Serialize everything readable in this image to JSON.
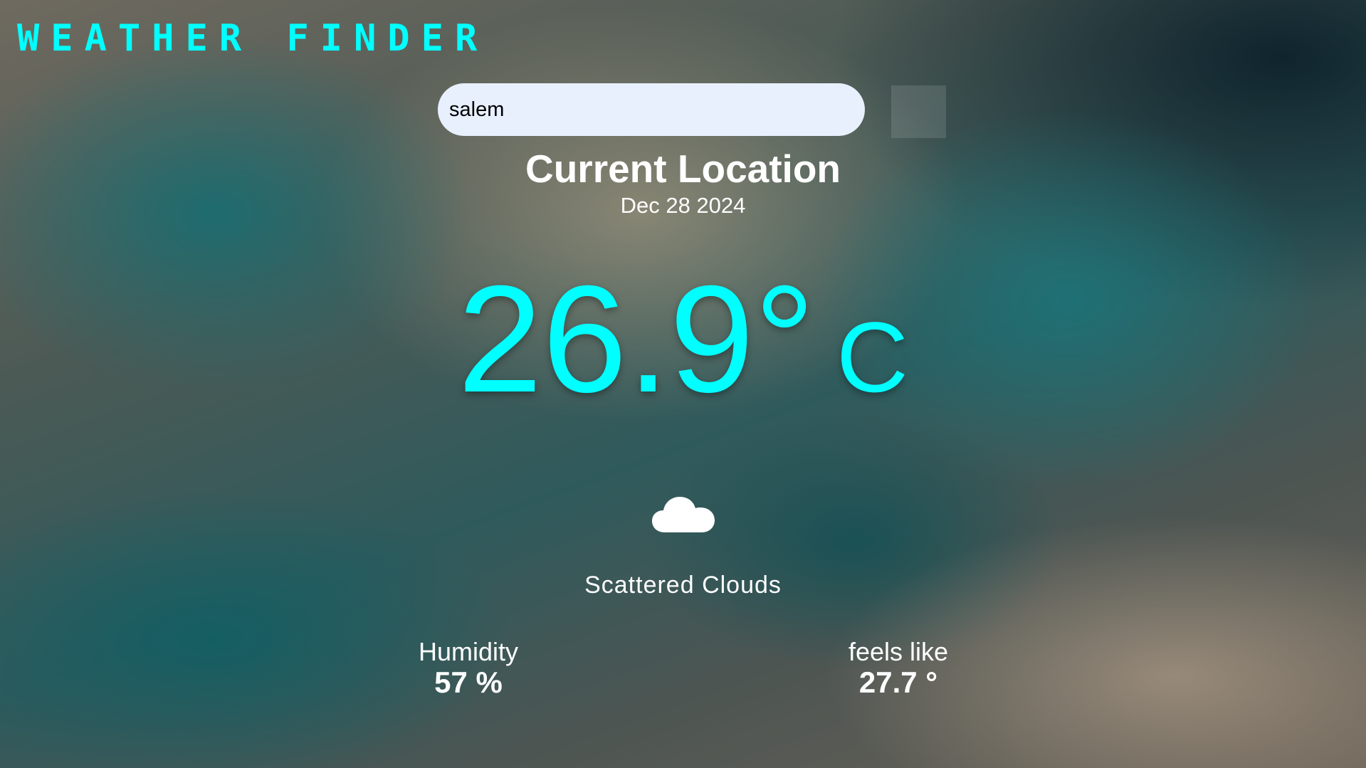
{
  "app": {
    "title": "WEATHER FINDER"
  },
  "search": {
    "value": "salem"
  },
  "location": {
    "title": "Current Location",
    "date": "Dec 28 2024"
  },
  "current": {
    "temperature": "26.9°",
    "unit": "C",
    "icon": "cloud-icon",
    "condition": "Scattered Clouds"
  },
  "stats": {
    "humidity": {
      "label": "Humidity",
      "value": "57 %"
    },
    "feels_like": {
      "label": "feels like",
      "value": "27.7 °"
    }
  },
  "colors": {
    "accent": "#00ffff",
    "search_bg": "#e8f0fe",
    "text": "#ffffff"
  }
}
